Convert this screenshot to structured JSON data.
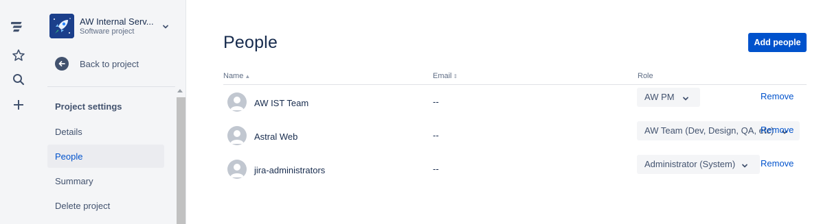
{
  "global_nav": {
    "icons": [
      "jira-logo-icon",
      "star-icon",
      "search-icon",
      "plus-icon"
    ]
  },
  "sidebar": {
    "project_name": "AW Internal Serv...",
    "project_type": "Software project",
    "back_label": "Back to project",
    "section_title": "Project settings",
    "items": [
      {
        "label": "Details",
        "active": false
      },
      {
        "label": "People",
        "active": true
      },
      {
        "label": "Summary",
        "active": false
      },
      {
        "label": "Delete project",
        "active": false
      }
    ]
  },
  "main": {
    "title": "People",
    "add_button": "Add people",
    "columns": {
      "name": "Name",
      "email": "Email",
      "role": "Role"
    },
    "rows": [
      {
        "name": "AW IST Team",
        "email": "--",
        "role": "AW PM",
        "action": "Remove"
      },
      {
        "name": "Astral Web",
        "email": "--",
        "role": "AW Team (Dev, Design, QA, etc)",
        "action": "Remove"
      },
      {
        "name": "jira-administrators",
        "email": "--",
        "role": "Administrator (System)",
        "action": "Remove"
      }
    ]
  },
  "colors": {
    "accent": "#0052cc",
    "sidebar_bg": "#f4f5f7",
    "text": "#172b4d"
  }
}
